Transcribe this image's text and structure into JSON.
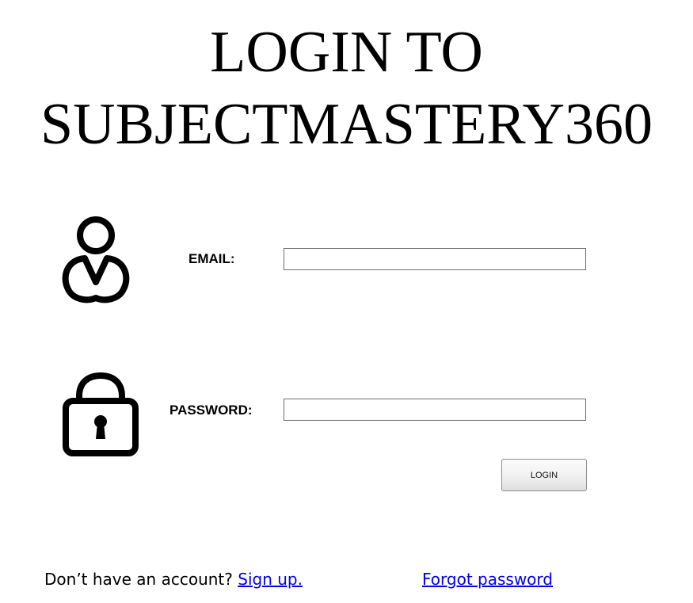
{
  "header": {
    "title_line1": "LOGIN TO",
    "title_line2": "SUBJECTMASTERY360"
  },
  "form": {
    "email_label": "EMAIL:",
    "email_value": "",
    "password_label": "PASSWORD:",
    "password_value": "",
    "login_button": "LOGIN"
  },
  "footer": {
    "signup_prompt": "Don’t have an account?",
    "signup_link": "Sign up.",
    "forgot_link": "Forgot password"
  },
  "icons": {
    "email": "user-icon",
    "password": "lock-icon"
  },
  "colors": {
    "link": "#0000ee",
    "field_border": "#6f6f6f"
  }
}
